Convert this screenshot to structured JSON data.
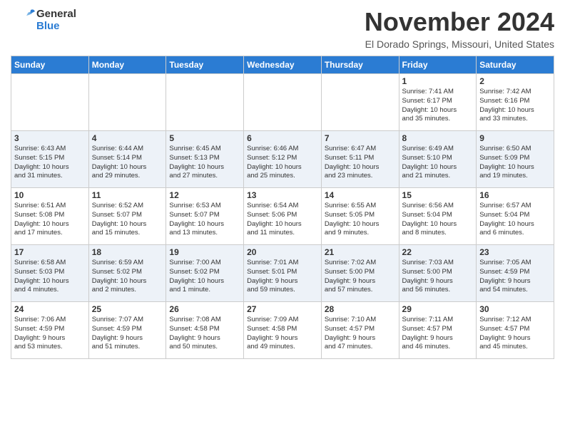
{
  "header": {
    "logo_line1": "General",
    "logo_line2": "Blue",
    "month_title": "November 2024",
    "location": "El Dorado Springs, Missouri, United States"
  },
  "days_of_week": [
    "Sunday",
    "Monday",
    "Tuesday",
    "Wednesday",
    "Thursday",
    "Friday",
    "Saturday"
  ],
  "weeks": [
    [
      {
        "day": "",
        "info": ""
      },
      {
        "day": "",
        "info": ""
      },
      {
        "day": "",
        "info": ""
      },
      {
        "day": "",
        "info": ""
      },
      {
        "day": "",
        "info": ""
      },
      {
        "day": "1",
        "info": "Sunrise: 7:41 AM\nSunset: 6:17 PM\nDaylight: 10 hours\nand 35 minutes."
      },
      {
        "day": "2",
        "info": "Sunrise: 7:42 AM\nSunset: 6:16 PM\nDaylight: 10 hours\nand 33 minutes."
      }
    ],
    [
      {
        "day": "3",
        "info": "Sunrise: 6:43 AM\nSunset: 5:15 PM\nDaylight: 10 hours\nand 31 minutes."
      },
      {
        "day": "4",
        "info": "Sunrise: 6:44 AM\nSunset: 5:14 PM\nDaylight: 10 hours\nand 29 minutes."
      },
      {
        "day": "5",
        "info": "Sunrise: 6:45 AM\nSunset: 5:13 PM\nDaylight: 10 hours\nand 27 minutes."
      },
      {
        "day": "6",
        "info": "Sunrise: 6:46 AM\nSunset: 5:12 PM\nDaylight: 10 hours\nand 25 minutes."
      },
      {
        "day": "7",
        "info": "Sunrise: 6:47 AM\nSunset: 5:11 PM\nDaylight: 10 hours\nand 23 minutes."
      },
      {
        "day": "8",
        "info": "Sunrise: 6:49 AM\nSunset: 5:10 PM\nDaylight: 10 hours\nand 21 minutes."
      },
      {
        "day": "9",
        "info": "Sunrise: 6:50 AM\nSunset: 5:09 PM\nDaylight: 10 hours\nand 19 minutes."
      }
    ],
    [
      {
        "day": "10",
        "info": "Sunrise: 6:51 AM\nSunset: 5:08 PM\nDaylight: 10 hours\nand 17 minutes."
      },
      {
        "day": "11",
        "info": "Sunrise: 6:52 AM\nSunset: 5:07 PM\nDaylight: 10 hours\nand 15 minutes."
      },
      {
        "day": "12",
        "info": "Sunrise: 6:53 AM\nSunset: 5:07 PM\nDaylight: 10 hours\nand 13 minutes."
      },
      {
        "day": "13",
        "info": "Sunrise: 6:54 AM\nSunset: 5:06 PM\nDaylight: 10 hours\nand 11 minutes."
      },
      {
        "day": "14",
        "info": "Sunrise: 6:55 AM\nSunset: 5:05 PM\nDaylight: 10 hours\nand 9 minutes."
      },
      {
        "day": "15",
        "info": "Sunrise: 6:56 AM\nSunset: 5:04 PM\nDaylight: 10 hours\nand 8 minutes."
      },
      {
        "day": "16",
        "info": "Sunrise: 6:57 AM\nSunset: 5:04 PM\nDaylight: 10 hours\nand 6 minutes."
      }
    ],
    [
      {
        "day": "17",
        "info": "Sunrise: 6:58 AM\nSunset: 5:03 PM\nDaylight: 10 hours\nand 4 minutes."
      },
      {
        "day": "18",
        "info": "Sunrise: 6:59 AM\nSunset: 5:02 PM\nDaylight: 10 hours\nand 2 minutes."
      },
      {
        "day": "19",
        "info": "Sunrise: 7:00 AM\nSunset: 5:02 PM\nDaylight: 10 hours\nand 1 minute."
      },
      {
        "day": "20",
        "info": "Sunrise: 7:01 AM\nSunset: 5:01 PM\nDaylight: 9 hours\nand 59 minutes."
      },
      {
        "day": "21",
        "info": "Sunrise: 7:02 AM\nSunset: 5:00 PM\nDaylight: 9 hours\nand 57 minutes."
      },
      {
        "day": "22",
        "info": "Sunrise: 7:03 AM\nSunset: 5:00 PM\nDaylight: 9 hours\nand 56 minutes."
      },
      {
        "day": "23",
        "info": "Sunrise: 7:05 AM\nSunset: 4:59 PM\nDaylight: 9 hours\nand 54 minutes."
      }
    ],
    [
      {
        "day": "24",
        "info": "Sunrise: 7:06 AM\nSunset: 4:59 PM\nDaylight: 9 hours\nand 53 minutes."
      },
      {
        "day": "25",
        "info": "Sunrise: 7:07 AM\nSunset: 4:59 PM\nDaylight: 9 hours\nand 51 minutes."
      },
      {
        "day": "26",
        "info": "Sunrise: 7:08 AM\nSunset: 4:58 PM\nDaylight: 9 hours\nand 50 minutes."
      },
      {
        "day": "27",
        "info": "Sunrise: 7:09 AM\nSunset: 4:58 PM\nDaylight: 9 hours\nand 49 minutes."
      },
      {
        "day": "28",
        "info": "Sunrise: 7:10 AM\nSunset: 4:57 PM\nDaylight: 9 hours\nand 47 minutes."
      },
      {
        "day": "29",
        "info": "Sunrise: 7:11 AM\nSunset: 4:57 PM\nDaylight: 9 hours\nand 46 minutes."
      },
      {
        "day": "30",
        "info": "Sunrise: 7:12 AM\nSunset: 4:57 PM\nDaylight: 9 hours\nand 45 minutes."
      }
    ]
  ]
}
